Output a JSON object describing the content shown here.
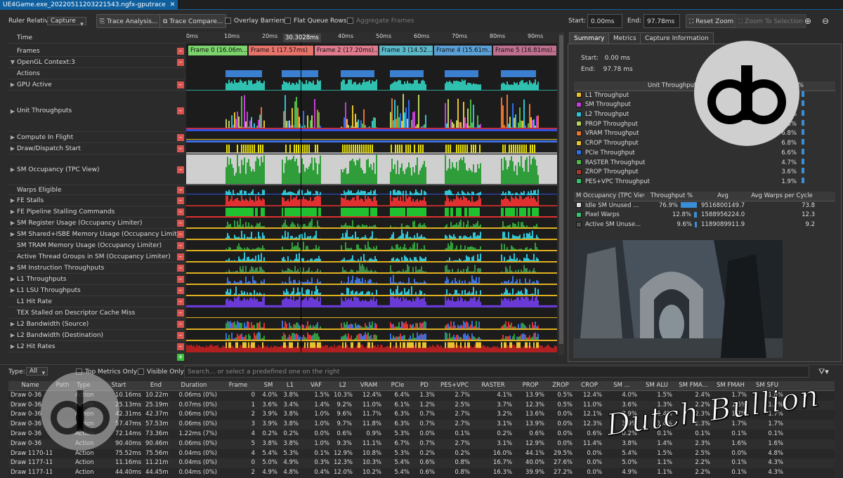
{
  "document_tab": {
    "title": "UE4Game.exe_20220511203221543.ngfx-gputrace",
    "close": "✕"
  },
  "toolbar": {
    "ruler_relative_label": "Ruler Relative:",
    "ruler_relative_value": "Capture",
    "trace_analysis": "Trace Analysis...",
    "trace_compare": "Trace Compare...",
    "overlay_barriers": "Overlay Barriers",
    "flat_queue_rows": "Flat Queue Rows",
    "aggregate_frames": "Aggregate Frames",
    "start_label": "Start:",
    "start_value": "0.00ms",
    "end_label": "End:",
    "end_value": "97.78ms",
    "reset_zoom": "Reset Zoom",
    "zoom_to_selection": "Zoom To Selection"
  },
  "ruler": {
    "ticks": [
      "0ms",
      "10ms",
      "20ms",
      "30ms",
      "40ms",
      "50ms",
      "60ms",
      "70ms",
      "80ms",
      "90ms"
    ],
    "cursor": "30.3028ms"
  },
  "rows": [
    {
      "label": "Time",
      "arrow": ""
    },
    {
      "label": "Frames",
      "arrow": ""
    },
    {
      "label": "OpenGL Context:3",
      "arrow": "▼"
    },
    {
      "label": "Actions",
      "arrow": ""
    },
    {
      "label": "GPU Active",
      "arrow": "▶"
    },
    {
      "label": "Unit Throughputs",
      "arrow": "▶"
    },
    {
      "label": "Compute In Flight",
      "arrow": "▶"
    },
    {
      "label": "Draw/Dispatch Start",
      "arrow": "▶"
    },
    {
      "label": "SM Occupancy (TPC View)",
      "arrow": "▶"
    },
    {
      "label": "Warps Eligible",
      "arrow": ""
    },
    {
      "label": "FE Stalls",
      "arrow": "▶"
    },
    {
      "label": "FE Pipeline Stalling Commands",
      "arrow": "▶"
    },
    {
      "label": "SM Register Usage (Occupancy Limiter)",
      "arrow": "▶"
    },
    {
      "label": "SM Shared+ISBE Memory Usage (Occupancy Limit...",
      "arrow": "▶"
    },
    {
      "label": "SM TRAM Memory Usage (Occupancy Limiter)",
      "arrow": ""
    },
    {
      "label": "Active Thread Groups in SM (Occupancy Limiter)",
      "arrow": ""
    },
    {
      "label": "SM Instruction Throughputs",
      "arrow": "▶"
    },
    {
      "label": "L1 Throughputs",
      "arrow": "▶"
    },
    {
      "label": "L1 LSU Throughputs",
      "arrow": "▶"
    },
    {
      "label": "L1 Hit Rate",
      "arrow": ""
    },
    {
      "label": "TEX Stalled on Descriptor Cache Miss",
      "arrow": ""
    },
    {
      "label": "L2 Bandwidth (Source)",
      "arrow": "▶"
    },
    {
      "label": "L2 Bandwidth (Destination)",
      "arrow": "▶"
    },
    {
      "label": "L2 Hit Rates",
      "arrow": "▶"
    }
  ],
  "frames": [
    {
      "label": "Frame 0 (16.06m...",
      "color": "#7bd36b"
    },
    {
      "label": "Frame 1 (17.57ms)",
      "color": "#e8736b"
    },
    {
      "label": "Frame 2 (17.20ms)...",
      "color": "#e07b8e"
    },
    {
      "label": "Frame 3 (14.52...",
      "color": "#5ab8c9"
    },
    {
      "label": "Frame 4 (15.61m...",
      "color": "#5aa0d6"
    },
    {
      "label": "Frame 5 (16.81ms)...",
      "color": "#c0708f"
    }
  ],
  "right_tabs": [
    "Summary",
    "Metrics",
    "Capture Information"
  ],
  "summary": {
    "start_label": "Start:",
    "start_value": "0.00 ms",
    "end_label": "End:",
    "end_value": "97.78 ms"
  },
  "unit_table": {
    "headers": [
      "Unit Throughputs",
      "Throughput %"
    ],
    "header_visible": "Unit Throughputs",
    "header_right_visible": "put %",
    "rows": [
      {
        "name": "L1 Throughput",
        "value": "…%",
        "color": "#e8c22e"
      },
      {
        "name": "SM Throughput",
        "value": "…%",
        "color": "#c23fd6"
      },
      {
        "name": "L2 Throughput",
        "value": "…4%",
        "color": "#2ec3d6"
      },
      {
        "name": "PROP Throughput",
        "value": "8.3%",
        "color": "#b7d25a"
      },
      {
        "name": "VRAM Throughput",
        "value": "6.8%",
        "color": "#e8732e"
      },
      {
        "name": "CROP Throughput",
        "value": "6.8%",
        "color": "#e8c22e"
      },
      {
        "name": "PCIe Throughput",
        "value": "6.6%",
        "color": "#2e6fe8"
      },
      {
        "name": "RASTER Throughput",
        "value": "4.7%",
        "color": "#52b848"
      },
      {
        "name": "ZROP Throughput",
        "value": "3.6%",
        "color": "#a83a2e"
      },
      {
        "name": "PES+VPC Throughput",
        "value": "1.9%",
        "color": "#3ac26a"
      }
    ]
  },
  "occupancy_table": {
    "headers": [
      "M Occupancy (TPC View",
      "Throughput %",
      "Avg",
      "Avg Warps per Cycle"
    ],
    "rows": [
      {
        "name": "Idle SM Unused ...",
        "pct": "76.9%",
        "fill": 0.769,
        "avg": "9516800149.7",
        "warps": "73.8",
        "color": "#dddddd"
      },
      {
        "name": "Pixel Warps",
        "pct": "12.8%",
        "fill": 0.128,
        "avg": "1588956224.0",
        "warps": "12.3",
        "color": "#3ac26a"
      },
      {
        "name": "Active SM Unuse...",
        "pct": "9.6%",
        "fill": 0.096,
        "avg": "1189089911.9",
        "warps": "9.2",
        "color": "#555555"
      }
    ]
  },
  "filter": {
    "type_label": "Type:",
    "type_value": "All",
    "top_metrics": "Top Metrics Only",
    "visible_only": "Visible Only",
    "search_placeholder": "Search... or select a predefined one on the right"
  },
  "bottom_table": {
    "headers": [
      "Name",
      "Path",
      "Type",
      "Start",
      "End",
      "Duration",
      "Frame",
      "SM",
      "L1",
      "VAF",
      "L2",
      "VRAM",
      "PCIe",
      "PD",
      "PES+VPC",
      "RASTER",
      "PROP",
      "ZROP",
      "CROP",
      "SM ...",
      "SM ALU",
      "SM FMA...",
      "SM FMAH",
      "SM SFU"
    ],
    "rows": [
      [
        "Draw 0-36",
        "",
        "Action",
        "10.16ms",
        "10.22ms",
        "0.06ms (0%)",
        "0",
        "4.0%",
        "3.8%",
        "1.5%",
        "10.3%",
        "12.4%",
        "6.4%",
        "1.3%",
        "2.7%",
        "4.1%",
        "13.9%",
        "0.5%",
        "12.4%",
        "4.0%",
        "1.5%",
        "2.4%",
        "1.7%",
        "1.8%"
      ],
      [
        "Draw 0-36",
        "",
        "Action",
        "25.13ms",
        "25.19ms",
        "0.07ms (0%)",
        "1",
        "3.6%",
        "3.4%",
        "1.4%",
        "9.2%",
        "11.0%",
        "6.1%",
        "1.2%",
        "2.5%",
        "3.7%",
        "12.3%",
        "0.5%",
        "11.0%",
        "3.6%",
        "1.3%",
        "2.2%",
        "1.5%",
        "1.6%"
      ],
      [
        "Draw 0-36",
        "",
        "Action",
        "42.31ms",
        "42.37ms",
        "0.06ms (0%)",
        "2",
        "3.9%",
        "3.8%",
        "1.0%",
        "9.6%",
        "11.7%",
        "6.3%",
        "0.7%",
        "2.7%",
        "3.2%",
        "13.6%",
        "0.0%",
        "12.1%",
        "3.9%",
        "1.4%",
        "2.3%",
        "1.7%",
        "1.7%"
      ],
      [
        "Draw 0-36",
        "",
        "Action",
        "57.47ms",
        "57.53ms",
        "0.06ms (0%)",
        "3",
        "3.9%",
        "3.8%",
        "1.0%",
        "9.7%",
        "11.8%",
        "6.3%",
        "0.7%",
        "2.7%",
        "3.1%",
        "13.9%",
        "0.0%",
        "12.3%",
        "3.9%",
        "1.4%",
        "2.3%",
        "1.7%",
        "1.7%"
      ],
      [
        "Draw 0-36",
        "",
        "Action",
        "72.14ms",
        "73.36ms",
        "1.22ms (7%)",
        "4",
        "0.2%",
        "0.2%",
        "0.0%",
        "0.6%",
        "0.9%",
        "5.3%",
        "0.0%",
        "0.1%",
        "0.2%",
        "0.6%",
        "0.0%",
        "0.6%",
        "0.2%",
        "0.1%",
        "0.1%",
        "0.1%",
        "0.1%"
      ],
      [
        "Draw 0-36",
        "",
        "Action",
        "90.40ms",
        "90.46ms",
        "0.06ms (0%)",
        "5",
        "3.8%",
        "3.8%",
        "1.0%",
        "9.3%",
        "11.1%",
        "6.7%",
        "0.7%",
        "2.7%",
        "3.1%",
        "12.9%",
        "0.0%",
        "11.4%",
        "3.8%",
        "1.4%",
        "2.3%",
        "1.6%",
        "1.6%"
      ],
      [
        "Draw 1170-1181",
        "",
        "Action",
        "75.52ms",
        "75.56ms",
        "0.04ms (0%)",
        "4",
        "5.4%",
        "5.3%",
        "0.1%",
        "12.9%",
        "10.8%",
        "5.3%",
        "0.2%",
        "0.2%",
        "16.0%",
        "44.1%",
        "29.5%",
        "0.0%",
        "5.4%",
        "1.5%",
        "2.5%",
        "0.0%",
        "4.8%"
      ],
      [
        "Draw 1177-1188",
        "",
        "Action",
        "11.16ms",
        "11.21ms",
        "0.04ms (0%)",
        "0",
        "5.0%",
        "4.9%",
        "0.3%",
        "12.3%",
        "10.3%",
        "5.4%",
        "0.6%",
        "0.8%",
        "16.7%",
        "40.0%",
        "27.6%",
        "0.0%",
        "5.0%",
        "1.1%",
        "2.2%",
        "0.1%",
        "4.3%"
      ],
      [
        "Draw 1177-1188",
        "",
        "Action",
        "44.40ms",
        "44.45ms",
        "0.04ms (0%)",
        "2",
        "4.9%",
        "4.8%",
        "0.4%",
        "12.0%",
        "10.2%",
        "5.4%",
        "0.6%",
        "0.8%",
        "16.3%",
        "39.9%",
        "27.2%",
        "0.0%",
        "4.9%",
        "1.1%",
        "2.2%",
        "0.1%",
        "4.3%"
      ]
    ]
  },
  "watermark_text": "Dutch Bullion",
  "colors": {
    "accent": "#0f5f9e",
    "remove": "#d9534f",
    "gpu_active": "#30c0b0",
    "draw_start": "#e8e000",
    "fe": "#e03030",
    "green": "#20c030",
    "purple": "#6a3ad6"
  }
}
